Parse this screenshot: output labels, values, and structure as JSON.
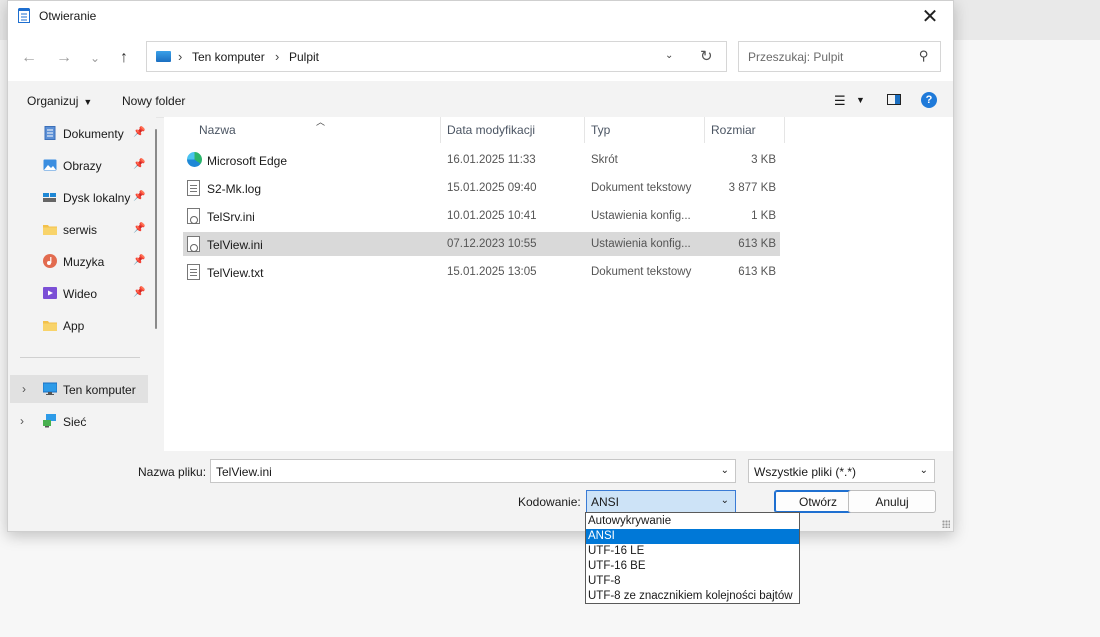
{
  "window": {
    "title": "Otwieranie"
  },
  "nav": {
    "back": "←",
    "forward": "→",
    "recent": "⌄",
    "up": "↑",
    "breadcrumb": [
      "Ten komputer",
      "Pulpit"
    ],
    "search_placeholder": "Przeszukaj: Pulpit"
  },
  "toolbar": {
    "organize": "Organizuj",
    "new_folder": "Nowy folder"
  },
  "sidebar": {
    "items": [
      {
        "label": "Dokumenty",
        "icon": "documents-icon"
      },
      {
        "label": "Obrazy",
        "icon": "pictures-icon"
      },
      {
        "label": "Dysk lokalny",
        "icon": "drive-icon"
      },
      {
        "label": "serwis",
        "icon": "folder-icon"
      },
      {
        "label": "Muzyka",
        "icon": "music-icon"
      },
      {
        "label": "Wideo",
        "icon": "video-icon"
      },
      {
        "label": "App",
        "icon": "folder-icon"
      }
    ],
    "tree": [
      {
        "label": "Ten komputer",
        "icon": "computer-icon",
        "selected": true
      },
      {
        "label": "Sieć",
        "icon": "network-icon",
        "selected": false
      }
    ]
  },
  "columns": {
    "name": "Nazwa",
    "date": "Data modyfikacji",
    "type": "Typ",
    "size": "Rozmiar"
  },
  "files": [
    {
      "name": "Microsoft Edge",
      "date": "16.01.2025 11:33",
      "type": "Skrót",
      "size": "3 KB",
      "icon": "edge-icon"
    },
    {
      "name": "S2-Mk.log",
      "date": "15.01.2025 09:40",
      "type": "Dokument tekstowy",
      "size": "3 877 KB",
      "icon": "text-file-icon"
    },
    {
      "name": "TelSrv.ini",
      "date": "10.01.2025 10:41",
      "type": "Ustawienia konfig...",
      "size": "1 KB",
      "icon": "settings-file-icon"
    },
    {
      "name": "TelView.ini",
      "date": "07.12.2023 10:55",
      "type": "Ustawienia konfig...",
      "size": "613 KB",
      "icon": "settings-file-icon",
      "selected": true
    },
    {
      "name": "TelView.txt",
      "date": "15.01.2025 13:05",
      "type": "Dokument tekstowy",
      "size": "613 KB",
      "icon": "text-file-icon"
    }
  ],
  "bottom": {
    "filename_label": "Nazwa pliku:",
    "filename_value": "TelView.ini",
    "filetype_value": "Wszystkie pliki  (*.*)",
    "encoding_label": "Kodowanie:",
    "encoding_value": "ANSI",
    "open_button": "Otwórz",
    "cancel_button": "Anuluj"
  },
  "encoding_options": [
    "Autowykrywanie",
    "ANSI",
    "UTF-16 LE",
    "UTF-16 BE",
    "UTF-8",
    "UTF-8 ze znacznikiem kolejności bajtów"
  ],
  "encoding_selected_index": 1,
  "colors": {
    "accent": "#0078d7",
    "selection_row": "#d9d9d9"
  }
}
